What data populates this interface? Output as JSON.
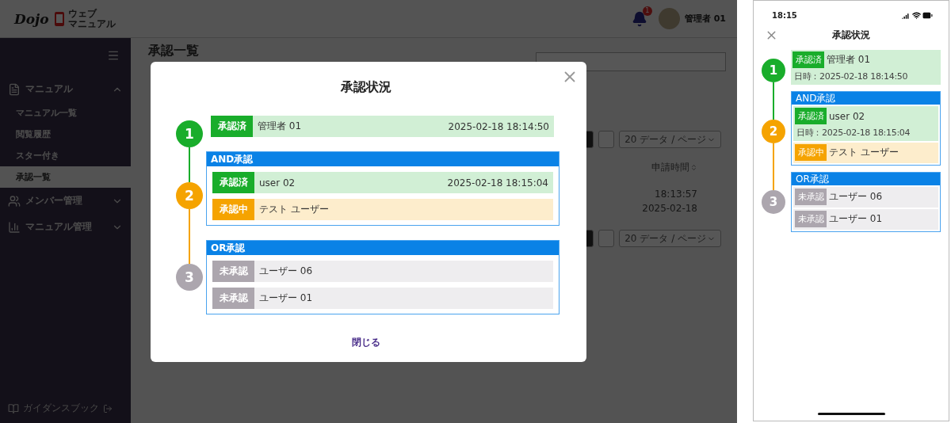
{
  "desktop": {
    "header": {
      "logo": "Dojo",
      "product_name_lines": [
        "ウェブ",
        "マニュアル"
      ],
      "notification_count": "1",
      "user_name": "管理者 01"
    },
    "sidebar": {
      "groups": [
        {
          "label": "マニュアル",
          "expanded": true,
          "children": [
            {
              "label": "マニュアル一覧",
              "selected": false
            },
            {
              "label": "閲覧履歴",
              "selected": false
            },
            {
              "label": "スター付き",
              "selected": false
            },
            {
              "label": "承認一覧",
              "selected": true
            }
          ]
        },
        {
          "label": "メンバー管理",
          "expanded": false
        },
        {
          "label": "マニュアル管理",
          "expanded": false
        }
      ],
      "footer": "ガイダンスブック"
    },
    "page": {
      "title": "承認一覧",
      "pagers": [
        {
          "page_size": "20 データ / ページ"
        },
        {
          "page_size": "20 データ / ページ"
        }
      ],
      "column_header": "申請時間",
      "cells": [
        "18:13:57",
        "2025-02-18"
      ]
    },
    "modal": {
      "title": "承認状況",
      "steps": [
        {
          "number": "1",
          "color": "#19ad2b",
          "entries": [
            {
              "badge": "承認済",
              "name": "管理者 01",
              "time": "2025-02-18 18:14:50",
              "color": "#19ad2b"
            }
          ]
        },
        {
          "number": "2",
          "color": "#f5a300",
          "group_label": "AND承認",
          "entries": [
            {
              "badge": "承認済",
              "name": "user 02",
              "time": "2025-02-18 18:15:04",
              "color": "#19ad2b"
            },
            {
              "badge": "承認中",
              "name": "テスト ユーザー",
              "color": "#f5a300"
            }
          ]
        },
        {
          "number": "3",
          "color": "#aca6ae",
          "group_label": "OR承認",
          "entries": [
            {
              "badge": "未承認",
              "name": "ユーザー 06",
              "color": "#aca6ae"
            },
            {
              "badge": "未承認",
              "name": "ユーザー 01",
              "color": "#aca6ae"
            }
          ]
        }
      ],
      "close_label": "閉じる"
    }
  },
  "mobile": {
    "time": "18:15",
    "title": "承認状況",
    "steps": [
      {
        "number": "1",
        "color": "#19ad2b",
        "entries": [
          {
            "badge": "承認済",
            "name": "管理者 01",
            "time": "日時：2025-02-18 18:14:50",
            "color": "#19ad2b"
          }
        ]
      },
      {
        "number": "2",
        "color": "#f5a300",
        "group_label": "AND承認",
        "entries": [
          {
            "badge": "承認済",
            "name": "user 02",
            "time": "日時：2025-02-18 18:15:04",
            "color": "#19ad2b"
          },
          {
            "badge": "承認中",
            "name": "テスト ユーザー",
            "color": "#f5a300"
          }
        ]
      },
      {
        "number": "3",
        "color": "#aca6ae",
        "group_label": "OR承認",
        "entries": [
          {
            "badge": "未承認",
            "name": "ユーザー 06",
            "color": "#aca6ae"
          },
          {
            "badge": "未承認",
            "name": "ユーザー 01",
            "color": "#aca6ae"
          }
        ]
      }
    ]
  }
}
